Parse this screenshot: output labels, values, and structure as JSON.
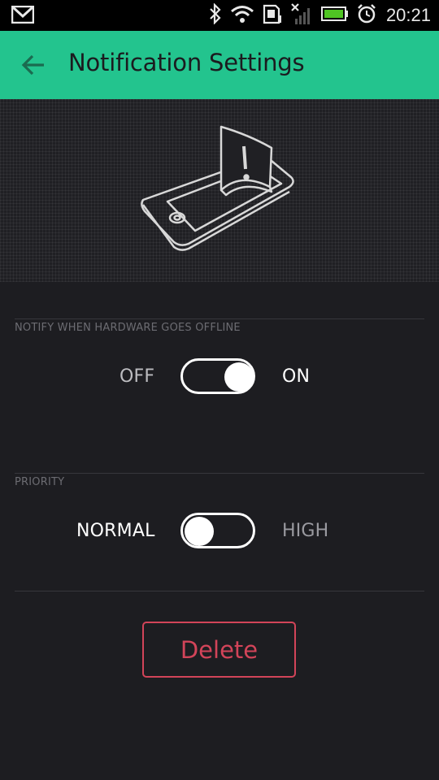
{
  "status_bar": {
    "time": "20:21",
    "icons": [
      "gmail-icon",
      "bluetooth-icon",
      "wifi-icon",
      "sd-card-icon",
      "no-signal-icon",
      "battery-icon",
      "alarm-icon"
    ]
  },
  "app_bar": {
    "title": "Notification Settings",
    "back_icon": "arrow-left-icon",
    "color": "#23c48e"
  },
  "hero": {
    "icon": "phone-notification-illustration"
  },
  "offline_section": {
    "label": "NOTIFY WHEN HARDWARE GOES OFFLINE",
    "off_label": "OFF",
    "on_label": "ON",
    "value": "ON"
  },
  "priority_section": {
    "label": "PRIORITY",
    "normal_label": "NORMAL",
    "high_label": "HIGH",
    "value": "NORMAL"
  },
  "delete_button": {
    "label": "Delete",
    "color": "#d24459"
  }
}
